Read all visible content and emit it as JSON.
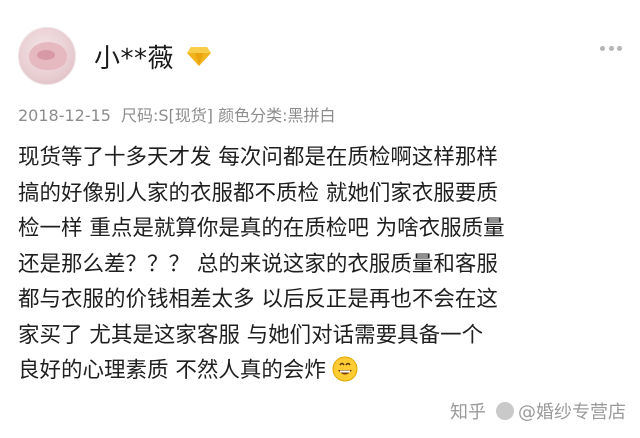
{
  "user": {
    "name": "小**薇",
    "badge_icon": "diamond-vip-icon"
  },
  "meta": {
    "date": "2018-12-15",
    "size": "尺码:S[现货]",
    "color": "颜色分类:黑拼白"
  },
  "review": {
    "lines": [
      "现货等了十多天才发 每次问都是在质检啊这样那样",
      "搞的好像别人家的衣服都不质检 就她们家衣服要质",
      "检一样 重点是就算你是真的在质检吧 为啥衣服质量",
      "还是那么差？？？ 总的来说这家的衣服质量和客服",
      "都与衣服的价钱相差太多 以后反正是再也不会在这",
      "家买了 尤其是这家客服 与她们对话需要具备一个",
      "良好的心理素质 不然人真的会炸"
    ],
    "emoji": "grinning-face-icon"
  },
  "watermark": {
    "site": "知乎",
    "author": "@婚纱专营店"
  },
  "colors": {
    "meta_text": "#8c8c8c",
    "body_text": "#1f1f1f",
    "badge_gold": "#f2b41c"
  }
}
